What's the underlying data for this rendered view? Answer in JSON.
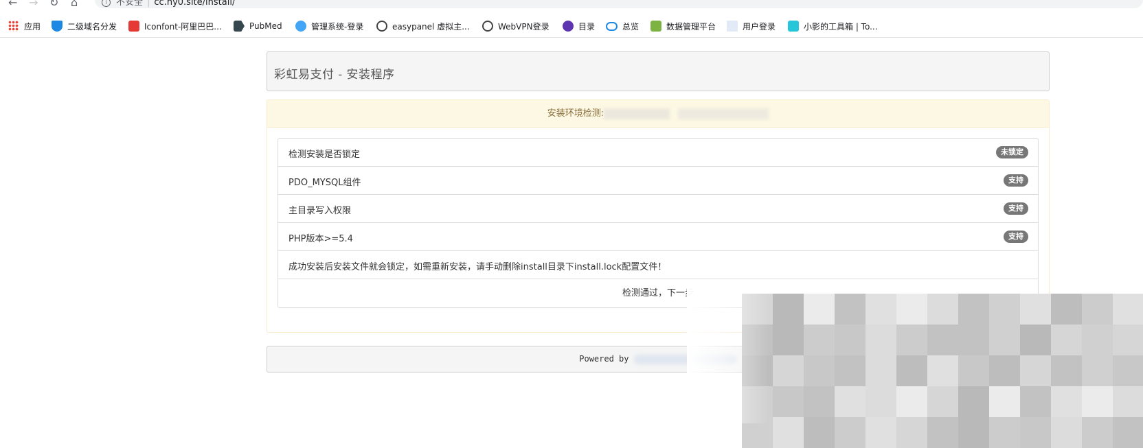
{
  "browser": {
    "security_label": "不安全",
    "url": "cc.hy0.site/install/",
    "bookmarks": [
      {
        "label": "应用",
        "icon": "apps-grid-icon",
        "color": "#ea4335"
      },
      {
        "label": "二级域名分发",
        "icon": "shield-y-icon",
        "color": "#1e88e5"
      },
      {
        "label": "Iconfont-阿里巴巴...",
        "icon": "iconfont-icon",
        "color": "#e53935"
      },
      {
        "label": "PubMed",
        "icon": "pubmed-icon",
        "color": "#37474f"
      },
      {
        "label": "管理系统-登录",
        "icon": "globe-blue-icon",
        "color": "#42a5f5"
      },
      {
        "label": "easypanel 虚拟主...",
        "icon": "globe-icon",
        "color": "#424242"
      },
      {
        "label": "WebVPN登录",
        "icon": "globe-icon",
        "color": "#424242"
      },
      {
        "label": "目录",
        "icon": "purple-logo-icon",
        "color": "#5e35b1"
      },
      {
        "label": "总览",
        "icon": "cloud-icon",
        "color": "#1e88e5"
      },
      {
        "label": "数据管理平台",
        "icon": "leaf-icon",
        "color": "#7cb342"
      },
      {
        "label": "用户登录",
        "icon": "blank-page-icon",
        "color": "#e3eaf7"
      },
      {
        "label": "小影的工具箱 | To...",
        "icon": "toolbox-icon",
        "color": "#26c6da"
      }
    ]
  },
  "page": {
    "title": "彩虹易支付 - 安装程序",
    "env_check_heading": "安装环境检测:",
    "checks": [
      {
        "label": "检测安装是否锁定",
        "status": "未锁定"
      },
      {
        "label": "PDO_MYSQL组件",
        "status": "支持"
      },
      {
        "label": "主目录写入权限",
        "status": "支持"
      },
      {
        "label": "PHP版本>=5.4",
        "status": "支持"
      }
    ],
    "notice": "成功安装后安装文件就会锁定，如需重新安装，请手动删除install目录下install.lock配置文件！",
    "next_label": "检测通过，下一步",
    "footer_text": "Powered by"
  },
  "colors": {
    "warning_bg": "#fcf8e3",
    "warning_text": "#8a6d3b",
    "badge_bg": "#777777"
  }
}
